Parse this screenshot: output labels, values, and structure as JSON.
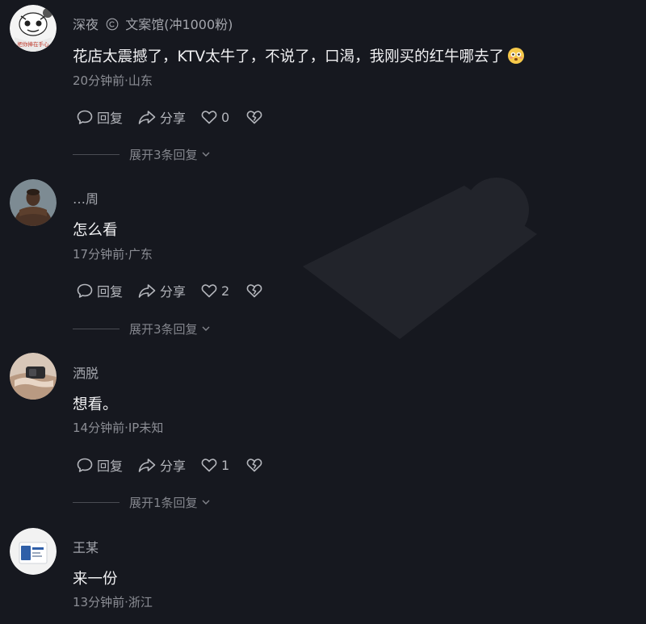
{
  "comments": [
    {
      "username": "深夜",
      "badge_icon": "copyright-circle-icon",
      "badge_text": "文案馆(冲1000粉)",
      "avatar_text": "把你捧在手心",
      "text": "花店太震撼了，KTV太牛了，不说了，口渴，我刚买的红牛哪去了",
      "emoji": "flushed-face-emoji",
      "meta": "20分钟前·山东",
      "reply_label": "回复",
      "share_label": "分享",
      "likes": "0",
      "expand_label": "展开3条回复"
    },
    {
      "username": "…周",
      "text": "怎么看",
      "meta": "17分钟前·广东",
      "reply_label": "回复",
      "share_label": "分享",
      "likes": "2",
      "expand_label": "展开3条回复"
    },
    {
      "username": "洒脱",
      "text": "想看。",
      "meta": "14分钟前·IP未知",
      "reply_label": "回复",
      "share_label": "分享",
      "likes": "1",
      "expand_label": "展开1条回复"
    },
    {
      "username": "王某",
      "text": "来一份",
      "meta": "13分钟前·浙江"
    }
  ],
  "colors": {
    "background": "#16181f",
    "primary_text": "#f0f0f2",
    "secondary_text": "#8c8e95"
  }
}
